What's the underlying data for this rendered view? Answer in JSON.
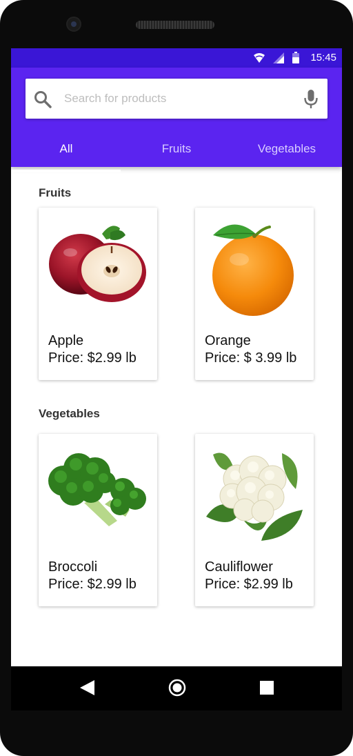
{
  "status_bar": {
    "time": "15:45"
  },
  "search": {
    "placeholder": "Search for products"
  },
  "tabs": [
    {
      "label": "All",
      "active": true
    },
    {
      "label": "Fruits",
      "active": false
    },
    {
      "label": "Vegetables",
      "active": false
    }
  ],
  "sections": [
    {
      "title": "Fruits",
      "items": [
        {
          "name": "Apple",
          "price": "Price: $2.99 lb",
          "image": "apple-image"
        },
        {
          "name": "Orange",
          "price": "Price: $ 3.99 lb",
          "image": "orange-image"
        }
      ]
    },
    {
      "title": "Vegetables",
      "items": [
        {
          "name": "Broccoli",
          "price": "Price: $2.99 lb",
          "image": "broccoli-image"
        },
        {
          "name": "Cauliflower",
          "price": "Price: $2.99 lb",
          "image": "cauliflower-image"
        }
      ]
    }
  ],
  "icons": {
    "search": "search-icon",
    "mic": "mic-icon",
    "wifi": "wifi-icon",
    "signal": "signal-icon",
    "battery": "battery-icon",
    "back": "back-icon",
    "home": "home-icon",
    "recent": "recent-apps-icon"
  },
  "colors": {
    "status_bar": "#3a16d6",
    "app_bar": "#5b24f0",
    "tab_active": "#ffffff",
    "tab_inactive": "#d9ceff"
  }
}
